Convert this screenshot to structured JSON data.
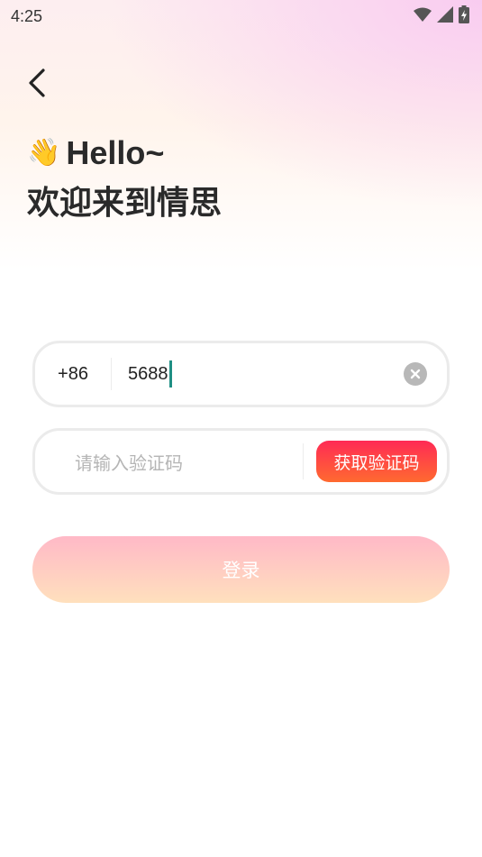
{
  "status_bar": {
    "time": "4:25",
    "icons": [
      "wifi-icon",
      "signal-icon",
      "battery-charging-icon"
    ]
  },
  "header": {
    "back_icon": "chevron-left-icon",
    "wave_emoji": "👋",
    "hello": "Hello~",
    "welcome": "欢迎来到情思"
  },
  "form": {
    "country_code": "+86",
    "phone_value": "5688",
    "clear_icon": "clear-circle-icon",
    "code_placeholder": "请输入验证码",
    "get_code_label": "获取验证码",
    "login_label": "登录"
  },
  "colors": {
    "accent_start": "#ff2a55",
    "accent_end": "#ff6a30",
    "login_start": "#ffb9c7",
    "login_end": "#ffe0bd",
    "caret": "#1f8f84"
  }
}
